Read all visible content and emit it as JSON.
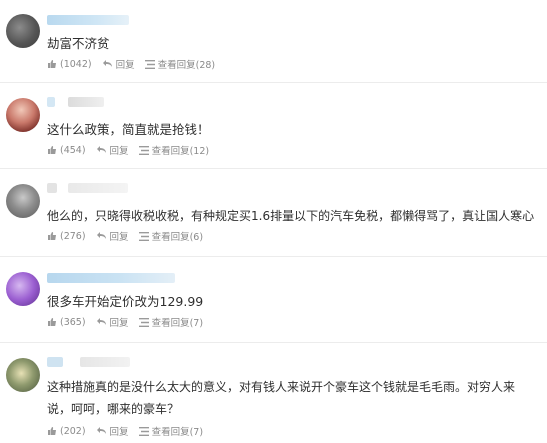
{
  "icons": {
    "like": "thumbs-up-icon",
    "reply": "reply-arrow-icon",
    "view_replies": "list-icon"
  },
  "comments": [
    {
      "text": "劫富不济贫",
      "likes": "(1042)",
      "reply_label": "回复",
      "view_replies_label": "查看回复(28)"
    },
    {
      "text": "这什么政策，简直就是抢钱！",
      "likes": "(454)",
      "reply_label": "回复",
      "view_replies_label": "查看回复(12)"
    },
    {
      "text": "他么的，只晓得收税收税，有种规定买1.6排量以下的汽车免税，都懒得骂了，真让国人寒心",
      "likes": "(276)",
      "reply_label": "回复",
      "view_replies_label": "查看回复(6)"
    },
    {
      "text": "很多车开始定价改为129.99",
      "likes": "(365)",
      "reply_label": "回复",
      "view_replies_label": "查看回复(7)"
    },
    {
      "text": "这种措施真的是没什么太大的意义，对有钱人来说开个豪车这个钱就是毛毛雨。对穷人来说，呵呵，哪来的豪车？",
      "likes": "(202)",
      "reply_label": "回复",
      "view_replies_label": "查看回复(7)"
    }
  ]
}
